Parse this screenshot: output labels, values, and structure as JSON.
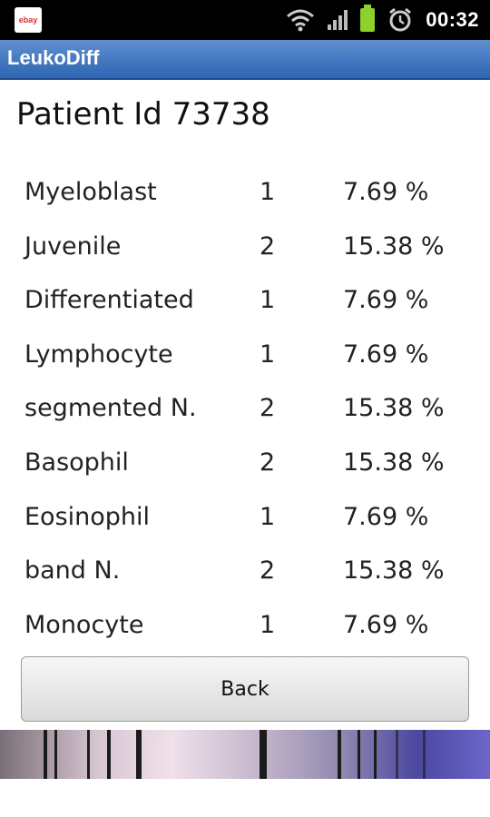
{
  "status_bar": {
    "time": "00:32",
    "notification_icon": "ebay-icon",
    "notification_text": "ebay",
    "icons": [
      "wifi-icon",
      "signal-icon",
      "battery-icon",
      "alarm-icon"
    ]
  },
  "app": {
    "title": "LeukoDiff"
  },
  "patient": {
    "label": "Patient Id 73738"
  },
  "rows": [
    {
      "name": "Myeloblast",
      "count": "1",
      "percent": "7.69 %"
    },
    {
      "name": "Juvenile",
      "count": "2",
      "percent": "15.38 %"
    },
    {
      "name": "Differentiated",
      "count": "1",
      "percent": "7.69 %"
    },
    {
      "name": "Lymphocyte",
      "count": "1",
      "percent": "7.69 %"
    },
    {
      "name": "segmented N.",
      "count": "2",
      "percent": "15.38 %"
    },
    {
      "name": "Basophil",
      "count": "2",
      "percent": "15.38 %"
    },
    {
      "name": "Eosinophil",
      "count": "1",
      "percent": "7.69 %"
    },
    {
      "name": "band N.",
      "count": "2",
      "percent": "15.38 %"
    },
    {
      "name": "Monocyte",
      "count": "1",
      "percent": "7.69 %"
    }
  ],
  "buttons": {
    "back_label": "Back"
  },
  "banner": {
    "icon": "interior-photo-banner"
  }
}
